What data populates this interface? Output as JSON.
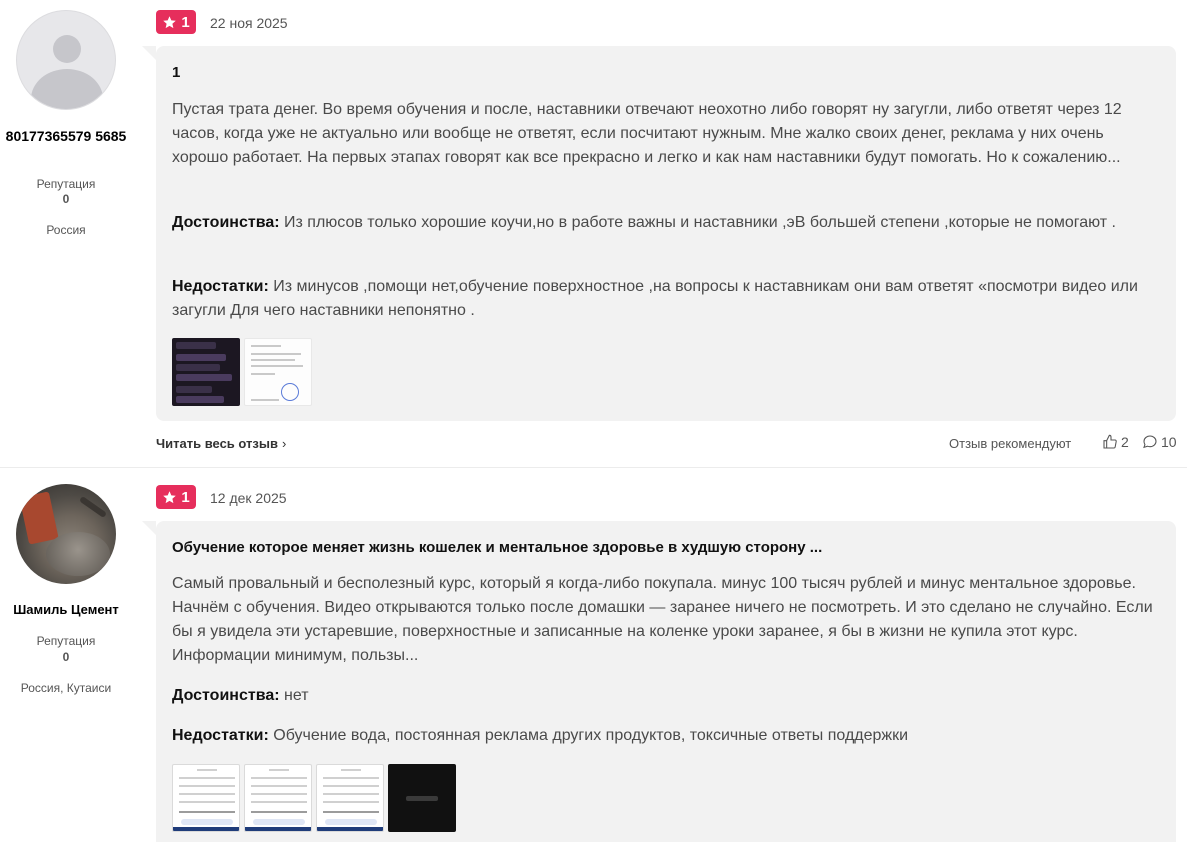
{
  "reviews": [
    {
      "author": {
        "name": "80177365579 5685",
        "reputation_label": "Репутация",
        "reputation_value": "0",
        "location": "Россия"
      },
      "rating": "1",
      "date": "22 ноя 2025",
      "title": "1",
      "body": "Пустая трата денег. Во время обучения и после, наставники отвечают неохотно либо говорят ну загугли, либо ответят через 12 часов, когда уже не актуально или вообще не ответят, если посчитают нужным. Мне жалко своих денег, реклама у них очень хорошо работает. На первых этапах говорят как все прекрасно и легко и как нам наставники будут помогать. Но к сожалению...",
      "pros_label": "Достоинства:",
      "pros": "Из плюсов только хорошие коучи,но в работе важны и наставники ,эВ большей степени ,которые не помогают .",
      "cons_label": "Недостатки:",
      "cons": "Из минусов ,помощи нет,обучение поверхностное ,на вопросы к наставникам они вам ответят «посмотри видео или загугли Для чего наставники непонятно .",
      "read_more": "Читать весь отзыв",
      "recommend": "Отзыв рекомендуют",
      "likes": "2",
      "comments": "10"
    },
    {
      "author": {
        "name": "Шамиль Цемент",
        "reputation_label": "Репутация",
        "reputation_value": "0",
        "location": "Россия, Кутаиси"
      },
      "rating": "1",
      "date": "12 дек 2025",
      "title": "Обучение которое меняет жизнь кошелек и ментальное здоровье в худшую сторону ...",
      "body": "Самый провальный и бесполезный курс, который я когда-либо покупала. минус 100 тысяч рублей и минус ментальное здоровье. Начнём с обучения. Видео открываются только после домашки — заранее ничего не посмотреть. И это сделано не случайно. Если бы я увидела эти устаревшие, поверхностные и записанные на коленке уроки заранее, я бы в жизни не купила этот курс. Информации минимум, пользы...",
      "pros_label": "Достоинства:",
      "pros": "нет",
      "cons_label": "Недостатки:",
      "cons": "Обучение вода, постоянная реклама других продуктов, токсичные ответы поддержки"
    }
  ],
  "icons": {
    "star": "star-icon",
    "like": "thumbs-up-icon",
    "comment": "comment-icon",
    "chevron": "chevron-right-icon"
  },
  "colors": {
    "rating_badge": "#e62e5c",
    "card_bg": "#f2f2f2"
  }
}
